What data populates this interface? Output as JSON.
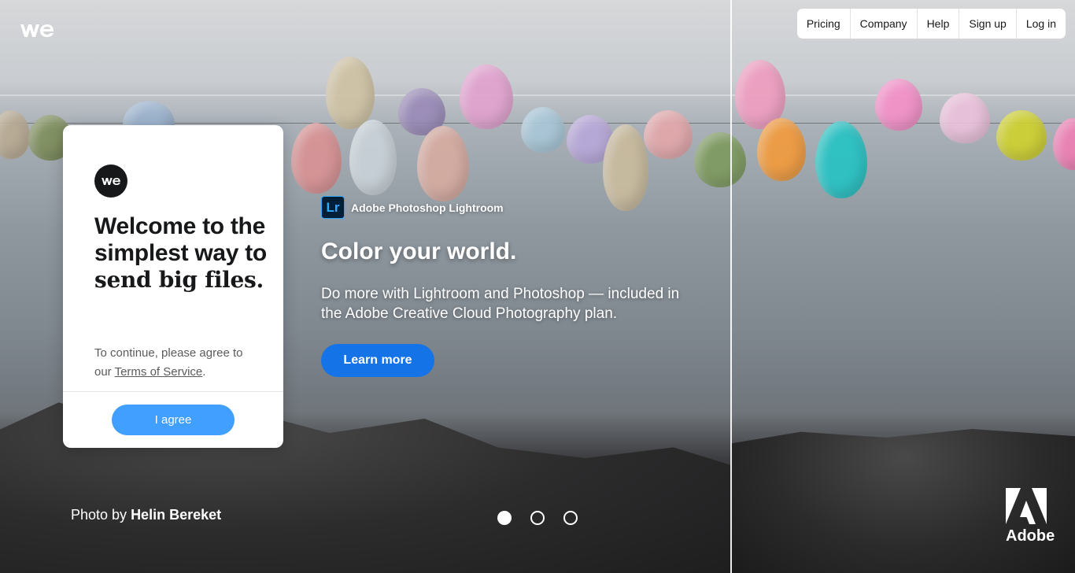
{
  "nav": {
    "items": [
      {
        "label": "Pricing"
      },
      {
        "label": "Company"
      },
      {
        "label": "Help"
      },
      {
        "label": "Sign up"
      },
      {
        "label": "Log in"
      }
    ]
  },
  "card": {
    "title_prefix": "Welcome to the simplest way to ",
    "title_bold": "send big files.",
    "text_prefix": "To continue, please agree to our ",
    "terms_link": "Terms of Service",
    "text_suffix": ".",
    "agree_label": "I agree"
  },
  "ad": {
    "icon_text": "Lr",
    "brand": "Adobe Photoshop Lightroom",
    "headline": "Color your world.",
    "body": "Do more with Lightroom and Photoshop — included in the Adobe Creative Cloud Photography plan.",
    "cta_label": "Learn more",
    "sponsor": "Adobe"
  },
  "credit": {
    "prefix": "Photo by ",
    "author": "Helin Bereket"
  },
  "carousel": {
    "active_index": 0,
    "count": 3
  },
  "colors": {
    "agree_button": "#409fff",
    "learn_button": "#1473e6"
  },
  "icons": {
    "brand_logo": "wetransfer-logo-icon",
    "ad_app": "lightroom-icon",
    "sponsor_logo": "adobe-logo-icon"
  }
}
